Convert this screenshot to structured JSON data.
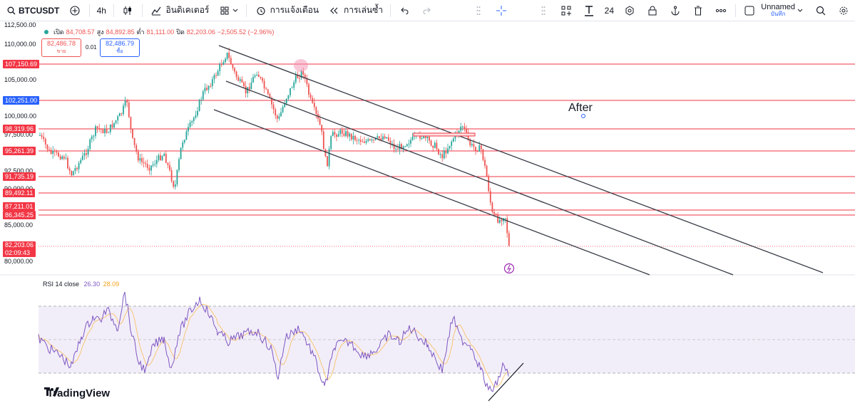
{
  "toolbar": {
    "symbol": "BTCUSDT",
    "interval": "4h",
    "indicators_label": "อินดิเคเตอร์",
    "alerts_label": "การแจ้งเตือน",
    "replay_label": "การเล่นซ้ำ",
    "font_size": "24",
    "layout_title": "Unnamed",
    "layout_sub": "บันทึก"
  },
  "legend": {
    "open_label": "เปิด",
    "open_value": "84,708.57",
    "high_label": "สูง",
    "high_value": "84,892.85",
    "low_label": "ต่ำ",
    "low_value": "81,111.00",
    "close_label": "ปิด",
    "close_value": "82,203.06",
    "change": "−2,505.52 (−2.96%)"
  },
  "trade": {
    "sell_price": "82,486.78",
    "sell_label": "ขาย",
    "spread": "0.01",
    "buy_price": "82,486.79",
    "buy_label": "ซื้อ"
  },
  "price_axis": [
    "112,500.00",
    "110,000.00",
    "105,000.00",
    "100,000.00",
    "97,500.00",
    "92,500.00",
    "90,000.00",
    "85,000.00",
    "80,000.00"
  ],
  "price_levels": {
    "l1": "107,150.69",
    "l2": "102,251.00",
    "l3": "98,319.96",
    "l4": "95,261.39",
    "l5": "91,735.19",
    "l6": "89,492.11",
    "l7": "87,211.01",
    "l8": "86,345.25",
    "current_price": "82,203.06",
    "countdown": "02:09:43"
  },
  "rsi": {
    "label": "RSI 14 close",
    "value_rsi": "26.30",
    "value_ma": "28.09"
  },
  "annotation": "After",
  "brand": "TradingView",
  "colors": {
    "level_line": "#f23645",
    "trendline": "#363a45",
    "up": "#26a69a",
    "down": "#ef5350",
    "rsi_line": "#7e57c2",
    "rsi_ma": "#f7c576",
    "rsi_band": "#ede7f6"
  }
}
